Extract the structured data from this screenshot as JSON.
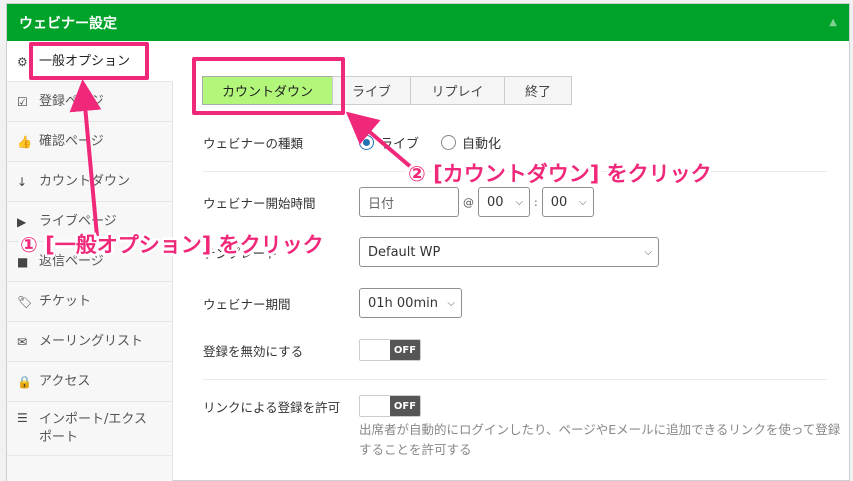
{
  "header": {
    "title": "ウェビナー設定",
    "collapse_icon": "triangle-up-icon"
  },
  "sidebar": {
    "items": [
      {
        "icon": "gear-icon",
        "glyph": "⚙",
        "label": "一般オプション",
        "active": true
      },
      {
        "icon": "check-square-icon",
        "glyph": "☑",
        "label": "登録ページ"
      },
      {
        "icon": "thumbs-up-icon",
        "glyph": "👍",
        "label": "確認ページ"
      },
      {
        "icon": "sort-down-icon",
        "glyph": "↓",
        "label": "カウントダウン"
      },
      {
        "icon": "play-icon",
        "glyph": "▶",
        "label": "ライブページ"
      },
      {
        "icon": "video-icon",
        "glyph": "■",
        "label": "返信ページ"
      },
      {
        "icon": "tags-icon",
        "glyph": "🏷",
        "label": "チケット"
      },
      {
        "icon": "envelope-icon",
        "glyph": "✉",
        "label": "メーリングリスト"
      },
      {
        "icon": "lock-icon",
        "glyph": "🔒",
        "label": "アクセス"
      },
      {
        "icon": "list-icon",
        "glyph": "☰",
        "label": "インポート/エクスポート"
      }
    ]
  },
  "tabs": [
    "カウントダウン",
    "ライブ",
    "リプレイ",
    "終了"
  ],
  "form": {
    "webinar_type": {
      "label": "ウェビナーの種類",
      "options": [
        "ライブ",
        "自動化"
      ],
      "selected": "ライブ"
    },
    "start_time": {
      "label": "ウェビナー開始時間",
      "date_placeholder": "日付",
      "at": "@",
      "hour": "00",
      "colon": ":",
      "minute": "00"
    },
    "template": {
      "label": "テンプレート",
      "value": "Default WP"
    },
    "duration": {
      "label": "ウェビナー期間",
      "value": "01h 00min"
    },
    "disable_registration": {
      "label": "登録を無効にする",
      "state": "OFF"
    },
    "link_registration": {
      "label": "リンクによる登録を許可",
      "state": "OFF",
      "help": "出席者が自動的にログインしたり、ページやEメールに追加できるリンクを使って登録することを許可する"
    }
  },
  "annotations": {
    "step1": "① [一般オプション] をクリック",
    "step2": "② [カウントダウン] をクリック",
    "color": "#f0287a"
  }
}
